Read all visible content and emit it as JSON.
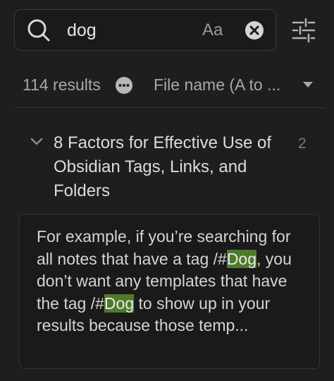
{
  "search": {
    "query": "dog",
    "case_toggle_label": "Aa"
  },
  "results_bar": {
    "count_label": "114 results",
    "sort_label": "File name (A to ..."
  },
  "result_file": {
    "title": "8 Factors for Effective Use of Obsidian Tags, Links, and Folders",
    "match_count": "2",
    "match": {
      "t1": "For example, if you’re searching for all notes that have a tag /#",
      "hl1": "Dog",
      "t2": ", you don’t want any templates that have the tag /#",
      "hl2": "Dog",
      "t3": " to show up in your results because those temp..."
    }
  },
  "colors": {
    "background": "#1e1e1e",
    "highlight": "#4e7a2a",
    "muted_text": "#a8a8a8"
  },
  "icons": [
    "search-icon",
    "close-circle-icon",
    "sliders-icon",
    "more-icon",
    "chevron-down-icon"
  ]
}
